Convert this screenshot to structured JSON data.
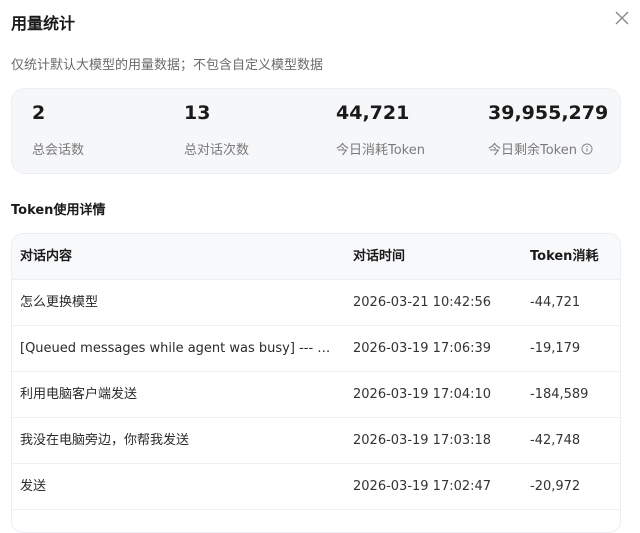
{
  "dialog": {
    "title": "用量统计",
    "subtitle": "仅统计默认大模型的用量数据；不包含自定义模型数据",
    "close_icon": "close-icon"
  },
  "stats": [
    {
      "value": "2",
      "label": "总会话数"
    },
    {
      "value": "13",
      "label": "总对话次数"
    },
    {
      "value": "44,721",
      "label": "今日消耗Token"
    },
    {
      "value": "39,955,279",
      "label": "今日剩余Token",
      "icon": "info-icon"
    }
  ],
  "details": {
    "title": "Token使用详情",
    "columns": [
      "对话内容",
      "对话时间",
      "Token消耗"
    ],
    "rows": [
      {
        "content": "怎么更换模型",
        "time": "2026-03-21 10:42:56",
        "tokens": "-44,721"
      },
      {
        "content": "[Queued messages while agent was busy] --- Que...",
        "time": "2026-03-19 17:06:39",
        "tokens": "-19,179"
      },
      {
        "content": "利用电脑客户端发送",
        "time": "2026-03-19 17:04:10",
        "tokens": "-184,589"
      },
      {
        "content": "我没在电脑旁边，你帮我发送",
        "time": "2026-03-19 17:03:18",
        "tokens": "-42,748"
      },
      {
        "content": "发送",
        "time": "2026-03-19 17:02:47",
        "tokens": "-20,972"
      }
    ]
  }
}
